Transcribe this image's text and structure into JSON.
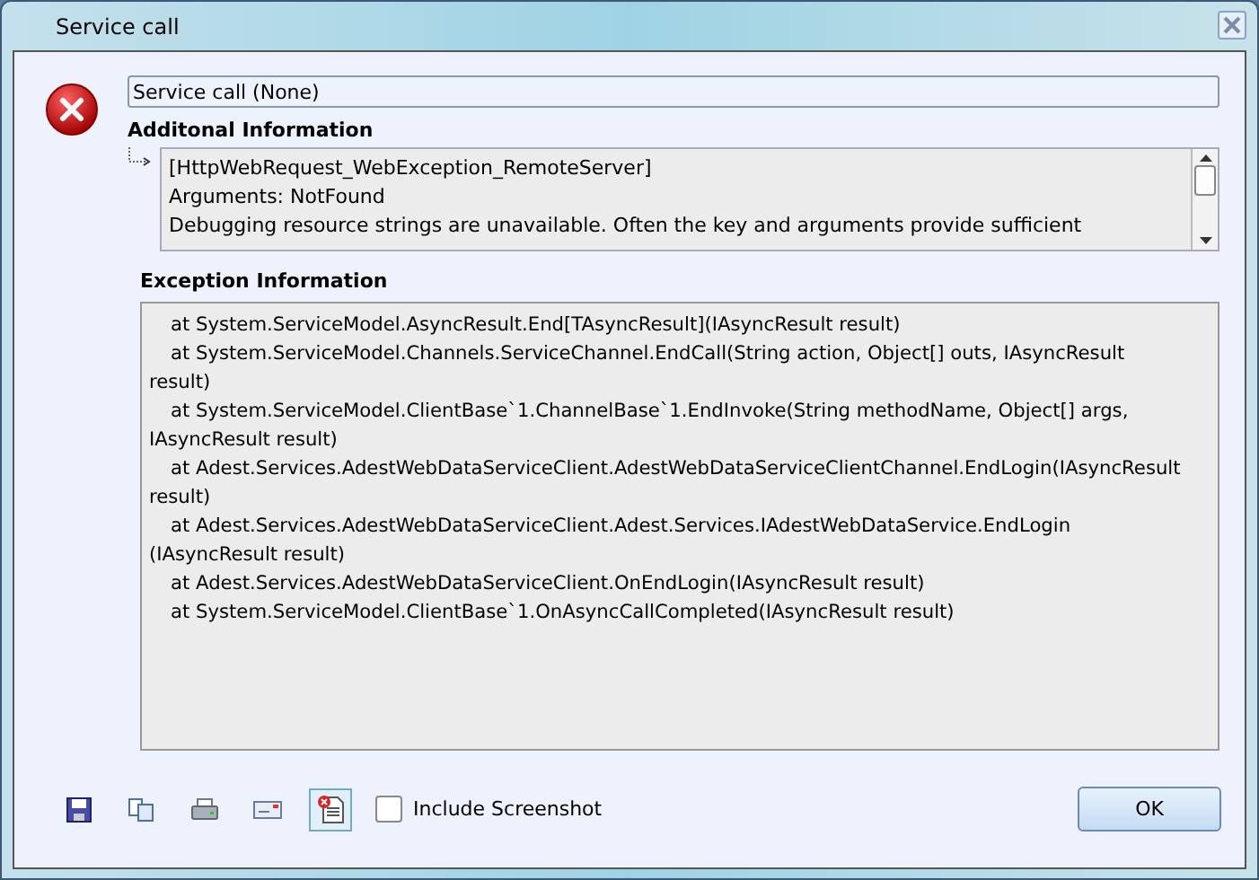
{
  "window": {
    "title": "Service call"
  },
  "message_field": {
    "value": "Service call (None)"
  },
  "additional_information": {
    "heading": "Additonal Information",
    "lines": [
      "[HttpWebRequest_WebException_RemoteServer]",
      "Arguments: NotFound",
      "Debugging resource strings are unavailable. Often the key and arguments provide sufficient"
    ]
  },
  "exception_information": {
    "heading": "Exception Information",
    "lines": [
      {
        "kind": "frame",
        "text": "at System.ServiceModel.AsyncResult.End[TAsyncResult](IAsyncResult result)"
      },
      {
        "kind": "frame",
        "text": "at System.ServiceModel.Channels.ServiceChannel.EndCall(String action, Object[] outs, IAsyncResult"
      },
      {
        "kind": "continuation",
        "text": "result)"
      },
      {
        "kind": "frame",
        "text": "at System.ServiceModel.ClientBase`1.ChannelBase`1.EndInvoke(String methodName, Object[] args,"
      },
      {
        "kind": "continuation",
        "text": "IAsyncResult result)"
      },
      {
        "kind": "frame",
        "text": "at Adest.Services.AdestWebDataServiceClient.AdestWebDataServiceClientChannel.EndLogin(IAsyncResult"
      },
      {
        "kind": "continuation",
        "text": "result)"
      },
      {
        "kind": "frame",
        "text": "at Adest.Services.AdestWebDataServiceClient.Adest.Services.IAdestWebDataService.EndLogin"
      },
      {
        "kind": "continuation",
        "text": "(IAsyncResult result)"
      },
      {
        "kind": "frame",
        "text": "at Adest.Services.AdestWebDataServiceClient.OnEndLogin(IAsyncResult result)"
      },
      {
        "kind": "frame",
        "text": "at System.ServiceModel.ClientBase`1.OnAsyncCallCompleted(IAsyncResult result)"
      }
    ]
  },
  "include_screenshot": {
    "label": "Include Screenshot",
    "checked": false
  },
  "buttons": [
    "OK"
  ]
}
